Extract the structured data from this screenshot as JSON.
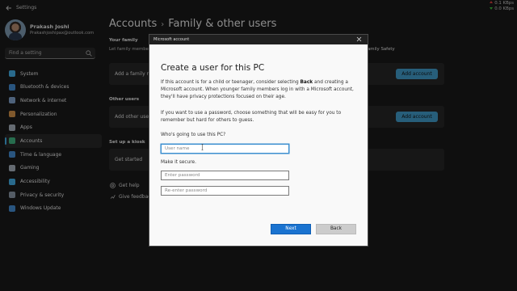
{
  "window": {
    "title": "Settings",
    "net_up": "0.1 KBps",
    "net_down": "0.0 KBps"
  },
  "profile": {
    "name": "Prakash Joshi",
    "email": "Prakashjoshipax@outlook.com"
  },
  "search": {
    "placeholder": "Find a setting"
  },
  "nav": {
    "items": [
      {
        "label": "System",
        "icon": "system-icon",
        "color": "#4cc2ff"
      },
      {
        "label": "Bluetooth & devices",
        "icon": "bluetooth-icon",
        "color": "#4c9be8"
      },
      {
        "label": "Network & internet",
        "icon": "network-icon",
        "color": "#8fb3e0"
      },
      {
        "label": "Personalization",
        "icon": "brush-icon",
        "color": "#e8a050"
      },
      {
        "label": "Apps",
        "icon": "apps-icon",
        "color": "#b8c4d0"
      },
      {
        "label": "Accounts",
        "icon": "accounts-icon",
        "color": "#48c78e"
      },
      {
        "label": "Time & language",
        "icon": "clock-language-icon",
        "color": "#4c9be8"
      },
      {
        "label": "Gaming",
        "icon": "gaming-icon",
        "color": "#b8c4d0"
      },
      {
        "label": "Accessibility",
        "icon": "accessibility-icon",
        "color": "#4cc2ff"
      },
      {
        "label": "Privacy & security",
        "icon": "shield-icon",
        "color": "#9aa8b8"
      },
      {
        "label": "Windows Update",
        "icon": "update-icon",
        "color": "#4c9be8"
      }
    ],
    "active_index": 5
  },
  "main": {
    "breadcrumb_parent": "Accounts",
    "breadcrumb_current": "Family & other users",
    "your_family_title": "Your family",
    "your_family_sub": "Let family members",
    "family_safety_link": "amily Safety",
    "add_family_text": "Add a family me",
    "add_account_label": "Add account",
    "other_users_title": "Other users",
    "add_other_text": "Add other user",
    "add_account_label_2": "Add account",
    "kiosk_title": "Set up a kiosk",
    "get_started": "Get started",
    "get_help": "Get help",
    "give_feedback": "Give feedback"
  },
  "dialog": {
    "window_title": "Microsoft account",
    "heading": "Create a user for this PC",
    "para1_a": "If this account is for a child or teenager, consider selecting ",
    "para1_bold": "Back",
    "para1_b": " and creating a Microsoft account. When younger family members log in with a Microsoft account, they'll have privacy protections focused on their age.",
    "para2": "If you want to use a password, choose something that will be easy for you to remember but hard for others to guess.",
    "who_label": "Who's going to use this PC?",
    "username_placeholder": "User name",
    "secure_label": "Make it secure.",
    "password_placeholder": "Enter password",
    "reenter_placeholder": "Re-enter password",
    "next_label": "Next",
    "back_label": "Back"
  }
}
